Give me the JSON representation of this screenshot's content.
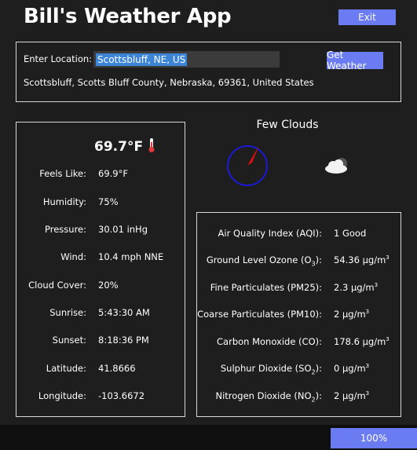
{
  "app": {
    "title": "Bill's Weather App",
    "exit_label": "Exit"
  },
  "location": {
    "label": "Enter Location:",
    "input_value": "Scottsbluff, NE, US",
    "button_label": "Get Weather",
    "resolved": "Scottsbluff, Scotts Bluff County, Nebraska, 69361, United States"
  },
  "weather": {
    "temperature": "69.7°F",
    "rows": [
      {
        "label": "Feels Like:",
        "value": "69.9°F"
      },
      {
        "label": "Humidity:",
        "value": "75%"
      },
      {
        "label": "Pressure:",
        "value": "30.01 inHg"
      },
      {
        "label": "Wind:",
        "value": "10.4 mph NNE"
      },
      {
        "label": "Cloud Cover:",
        "value": "20%"
      },
      {
        "label": "Sunrise:",
        "value": "5:43:30 AM"
      },
      {
        "label": "Sunset:",
        "value": "8:18:36 PM"
      },
      {
        "label": "Latitude:",
        "value": "41.8666"
      },
      {
        "label": "Longitude:",
        "value": "-103.6672"
      }
    ],
    "description": "Few Clouds",
    "icons": {
      "temperature": "thermometer-icon",
      "wind": "compass-icon",
      "condition": "cloud-icon"
    },
    "colors": {
      "compass_ring": "#1a1ad8",
      "compass_needle": "#e01010",
      "accent": "#6b7cf2"
    }
  },
  "air_quality": {
    "rows": [
      {
        "label": "Air Quality Index (AQI):",
        "value": "1 Good"
      },
      {
        "label_main": "Ground Level Ozone (O",
        "label_sub": "3",
        "label_end": "):",
        "value": "54.36 μg/m",
        "unit_sup": "3"
      },
      {
        "label": "Fine Particulates (PM25):",
        "value": "2.3 μg/m",
        "unit_sup": "3"
      },
      {
        "label": "Coarse Particulates (PM10):",
        "value": "2 μg/m",
        "unit_sup": "3"
      },
      {
        "label": "Carbon Monoxide (CO):",
        "value": "178.6 μg/m",
        "unit_sup": "3"
      },
      {
        "label_main": "Sulphur Dioxide (SO",
        "label_sub": "2",
        "label_end": "):",
        "value": "0 μg/m",
        "unit_sup": "3"
      },
      {
        "label_main": "Nitrogen Dioxide (NO",
        "label_sub": "2",
        "label_end": "):",
        "value": "2 μg/m",
        "unit_sup": "3"
      }
    ]
  },
  "footer": {
    "zoom_label": "100%"
  }
}
